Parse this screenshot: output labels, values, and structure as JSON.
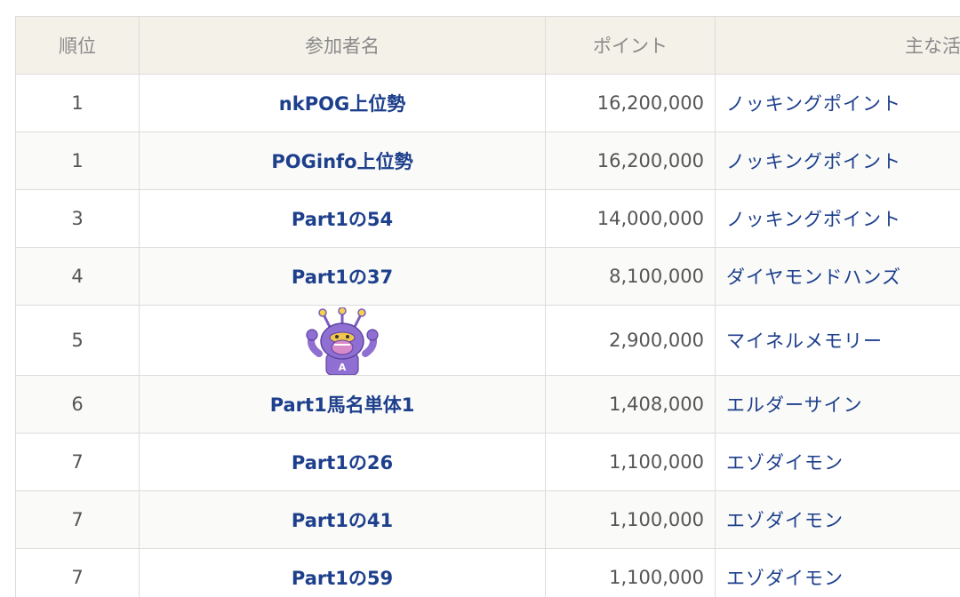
{
  "table": {
    "headers": {
      "rank": "順位",
      "name": "参加者名",
      "points": "ポイント",
      "main_horse": "主な活"
    },
    "rows": [
      {
        "rank": "1",
        "name": "nkPOG上位勢",
        "points": "16,200,000",
        "horse": "ノッキングポイント"
      },
      {
        "rank": "1",
        "name": "POGinfo上位勢",
        "points": "16,200,000",
        "horse": "ノッキングポイント"
      },
      {
        "rank": "3",
        "name": "Part1の54",
        "points": "14,000,000",
        "horse": "ノッキングポイント"
      },
      {
        "rank": "4",
        "name": "Part1の37",
        "points": "8,100,000",
        "horse": "ダイヤモンドハンズ"
      },
      {
        "rank": "5",
        "name": "",
        "points": "2,900,000",
        "horse": "マイネルメモリー",
        "avatar_icon": "mascot-avatar-icon"
      },
      {
        "rank": "6",
        "name": "Part1馬名単体1",
        "points": "1,408,000",
        "horse": "エルダーサイン"
      },
      {
        "rank": "7",
        "name": "Part1の26",
        "points": "1,100,000",
        "horse": "エゾダイモン"
      },
      {
        "rank": "7",
        "name": "Part1の41",
        "points": "1,100,000",
        "horse": "エゾダイモン"
      },
      {
        "rank": "7",
        "name": "Part1の59",
        "points": "1,100,000",
        "horse": "エゾダイモン"
      }
    ]
  },
  "colors": {
    "link": "#1d3f8c",
    "header_bg": "#f4f1e8",
    "border": "#dcdcdc",
    "mascot": "#8f6fd1"
  }
}
